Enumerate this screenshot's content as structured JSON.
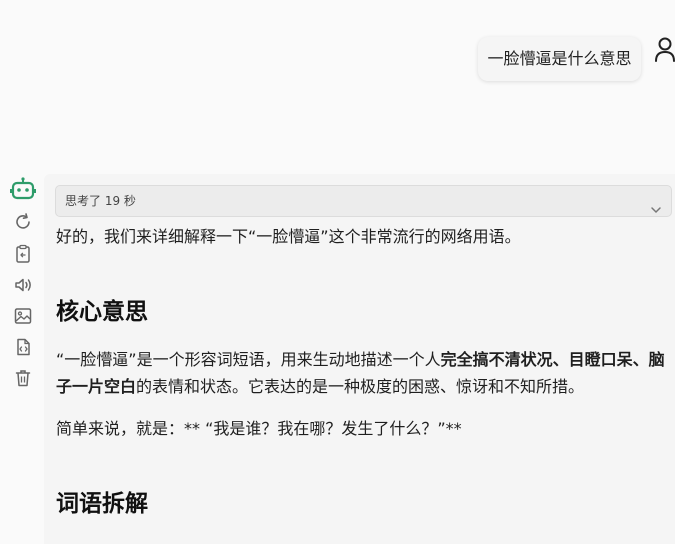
{
  "user_message": {
    "text": "一脸懵逼是什么意思",
    "avatar_icon": "user-icon"
  },
  "assistant": {
    "avatar_icon": "robot-icon",
    "accent_color": "#2e9c6a",
    "toolbar_icons": [
      "refresh-icon",
      "copy-icon",
      "speaker-icon",
      "image-icon",
      "code-file-icon",
      "trash-icon"
    ],
    "thinking_label": "思考了 19 秒",
    "intro": "好的，我们来详细解释一下“一脸懵逼”这个非常流行的网络用语。",
    "section1_heading": "核心意思",
    "section1_para_a": "“一脸懵逼”是一个形容词短语，用来生动地描述一个人",
    "section1_para_bold": "完全搞不清状况、目瞪口呆、脑子一片空白",
    "section1_para_b": "的表情和状态。它表达的是一种极度的困惑、惊讶和不知所措。",
    "section1_summary": "简单来说，就是：** “我是谁？我在哪？发生了什么？”**",
    "section2_heading": "词语拆解"
  }
}
